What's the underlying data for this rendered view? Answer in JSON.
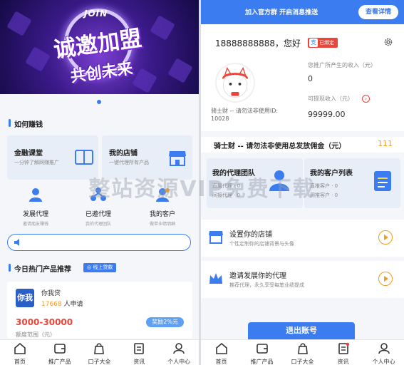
{
  "left": {
    "banner": {
      "top_text": "JOIN",
      "main_text": "诚邀加盟",
      "sub_text": "共创未来"
    },
    "section_earn": {
      "title": "如何赚钱"
    },
    "cards": [
      {
        "title": "金融课堂",
        "subtitle": "一分钟了解网赚推广"
      },
      {
        "title": "我的店铺",
        "subtitle": "一键代理所有产品"
      }
    ],
    "icons": [
      {
        "title": "发展代理",
        "subtitle": "邀请朋友赚钱"
      },
      {
        "title": "已邀代理",
        "subtitle": "我的代理团队"
      },
      {
        "title": "我的客户",
        "subtitle": "做单业绩明细"
      }
    ],
    "section_hot": {
      "title": "今日热门产品推荐",
      "tag": "◎ 线上贷款"
    },
    "product": {
      "logo": "你我",
      "name": "你我贷",
      "count": "17668",
      "count_suffix": "人申请",
      "amount": "3000-30000",
      "reward": "奖励2%元",
      "range": "额度范围（元）"
    }
  },
  "right": {
    "topbar": {
      "message": "加入官方群  开启消息推送",
      "button": "查看详情"
    },
    "user": {
      "phone": "18888888888，您好",
      "bound": "已绑定",
      "name": "骑士财 -- 请勿法非使用ID:",
      "id": "10028",
      "income_label": "您推广所产生的收入（元）",
      "income_value": "0",
      "withdraw_label": "可提现收入（元）",
      "withdraw_arrow": "›",
      "withdraw_value": "99999.00"
    },
    "commission": {
      "title": "骑士财 -- 请勿法非使用总发放佣金（元）",
      "value": "111"
    },
    "team_cards": [
      {
        "title": "我的代理团队",
        "line1": "直属代理 · 0",
        "line2": "间接代理 · 0"
      },
      {
        "title": "我的客户列表",
        "line1": "直推客户 · 0",
        "line2": "间推客户 · 0"
      }
    ],
    "rows": [
      {
        "title": "设置你的店铺",
        "subtitle": "个性定制你的店铺背景与头像"
      },
      {
        "title": "邀请发展你的代理",
        "subtitle": "推荐代理，永久享受每笔业绩提成"
      }
    ],
    "logout": "退出账号"
  },
  "tabs": [
    "首页",
    "推广产品",
    "口子大全",
    "资讯",
    "个人中心"
  ],
  "watermark": "整站资源VIP免费下载",
  "colors": {
    "accent": "#3b7cf0",
    "red": "#e8463a",
    "orange": "#f29b1d"
  }
}
